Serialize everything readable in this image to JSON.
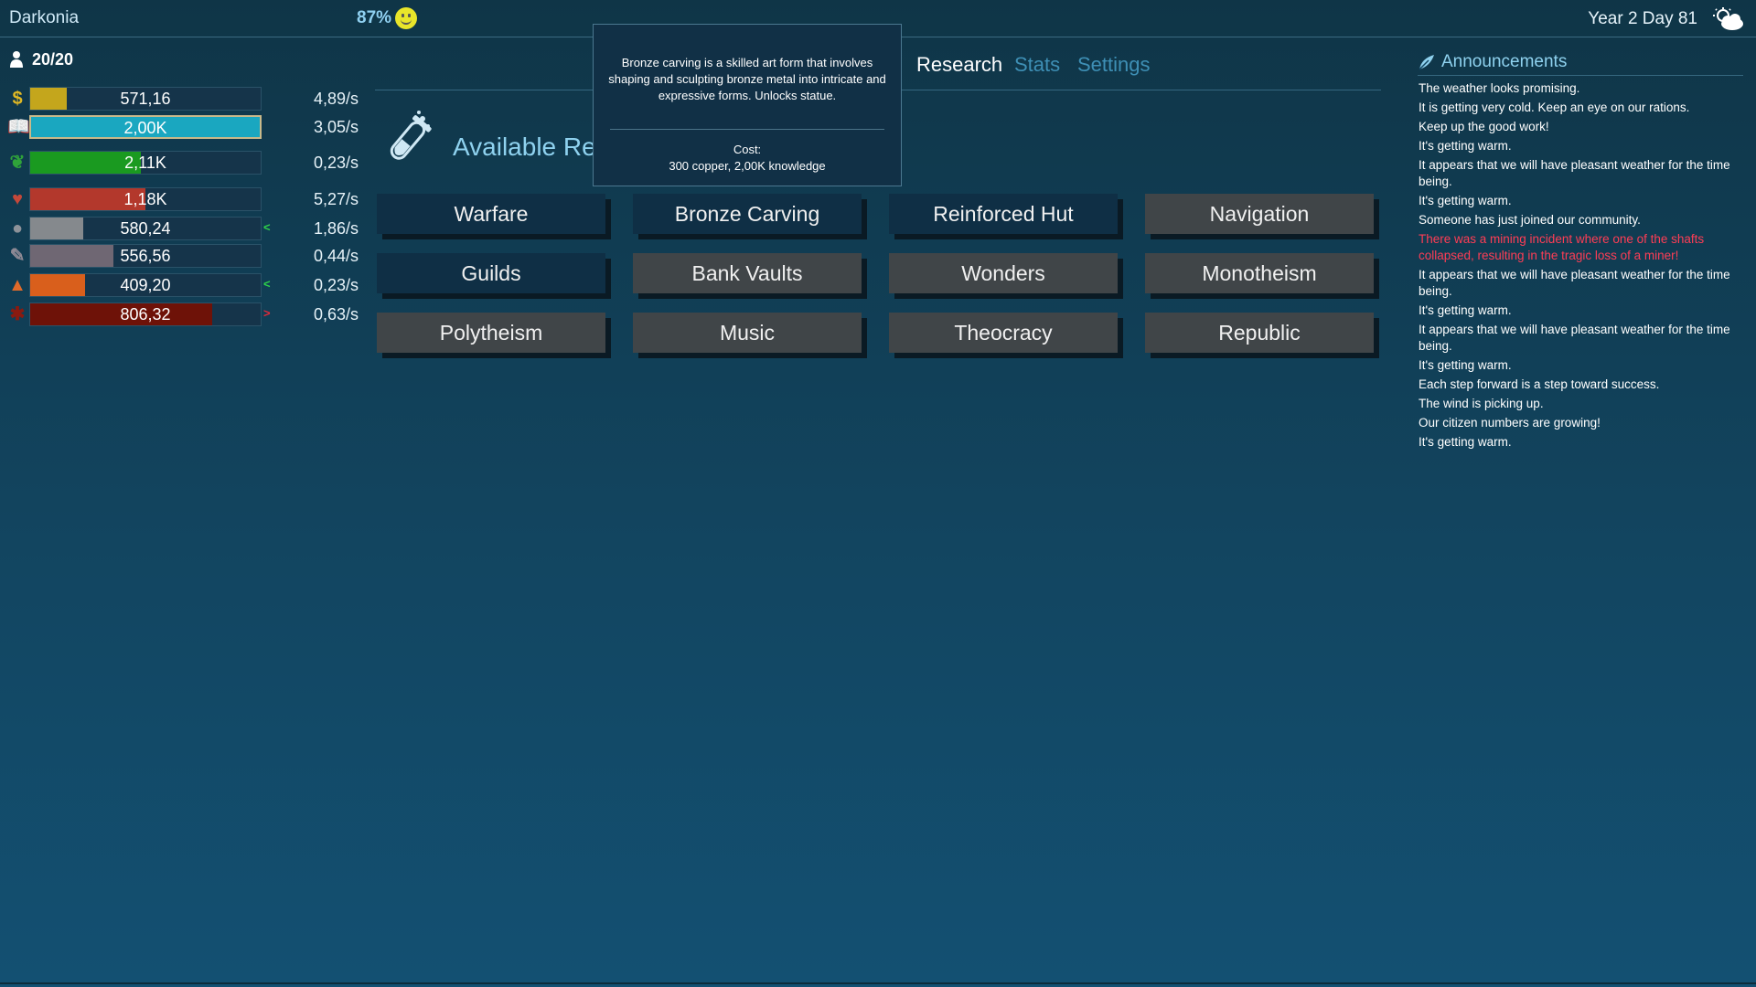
{
  "header": {
    "city_name": "Darkonia",
    "happiness": "87%",
    "date": "Year 2 Day 81",
    "weather_icon": "cloudy-sun-icon"
  },
  "population": {
    "icon": "person-icon",
    "count": "20/20"
  },
  "resources": [
    {
      "icon": "dollar-icon",
      "symbol": "$",
      "icon_color": "#e0b824",
      "value": "571,16",
      "rate": "4,89/s",
      "fill": 0.16,
      "fill_color": "#c4a61c",
      "trend": "",
      "trend_color": ""
    },
    {
      "icon": "book-icon",
      "symbol": "📖",
      "icon_color": "#27a3bd",
      "value": "2,00K",
      "rate": "3,05/s",
      "fill": 1.0,
      "fill_color": "#1aa7c0",
      "trend": "",
      "trend_color": ""
    },
    {
      "icon": "wheat-icon",
      "symbol": "❦",
      "icon_color": "#2fa33a",
      "value": "2,11K",
      "rate": "0,23/s",
      "fill": 0.48,
      "fill_color": "#1a9a20",
      "trend": "",
      "trend_color": ""
    },
    {
      "icon": "meat-icon",
      "symbol": "♥",
      "icon_color": "#c4483a",
      "value": "1,18K",
      "rate": "5,27/s",
      "fill": 0.5,
      "fill_color": "#b3382c",
      "trend": "",
      "trend_color": ""
    },
    {
      "icon": "stone-icon",
      "symbol": "●",
      "icon_color": "#8d9299",
      "value": "580,24",
      "rate": "1,86/s",
      "fill": 0.23,
      "fill_color": "#85898d",
      "trend": "<",
      "trend_color": "#2ed24a"
    },
    {
      "icon": "tool-icon",
      "symbol": "✎",
      "icon_color": "#8f8a95",
      "value": "556,56",
      "rate": "0,44/s",
      "fill": 0.36,
      "fill_color": "#6f6773",
      "trend": "",
      "trend_color": ""
    },
    {
      "icon": "copper-icon",
      "symbol": "▲",
      "icon_color": "#e06a2a",
      "value": "409,20",
      "rate": "0,23/s",
      "fill": 0.24,
      "fill_color": "#d95f1c",
      "trend": "<",
      "trend_color": "#2ed24a"
    },
    {
      "icon": "leather-icon",
      "symbol": "✱",
      "icon_color": "#8a1a10",
      "value": "806,32",
      "rate": "0,63/s",
      "fill": 0.79,
      "fill_color": "#6e1208",
      "trend": ">",
      "trend_color": "#e12a3a"
    }
  ],
  "tabs": {
    "research": "Research",
    "stats": "Stats",
    "settings": "Settings"
  },
  "research": {
    "icon": "flask-icon",
    "title": "Available Research",
    "buttons": [
      {
        "label": "Warfare",
        "state": "affordable"
      },
      {
        "label": "Bronze Carving",
        "state": "affordable"
      },
      {
        "label": "Reinforced Hut",
        "state": "affordable"
      },
      {
        "label": "Navigation",
        "state": "locked"
      },
      {
        "label": "Guilds",
        "state": "affordable"
      },
      {
        "label": "Bank Vaults",
        "state": "locked"
      },
      {
        "label": "Wonders",
        "state": "locked"
      },
      {
        "label": "Monotheism",
        "state": "locked"
      },
      {
        "label": "Polytheism",
        "state": "locked"
      },
      {
        "label": "Music",
        "state": "locked"
      },
      {
        "label": "Theocracy",
        "state": "locked"
      },
      {
        "label": "Republic",
        "state": "locked"
      }
    ]
  },
  "tooltip": {
    "description": "Bronze carving is a skilled art form that involves shaping and sculpting bronze metal into intricate and expressive forms. Unlocks statue.",
    "cost_label": "Cost:",
    "cost": "300 copper, 2,00K knowledge"
  },
  "announcements": {
    "icon": "quill-icon",
    "title": "Announcements",
    "items": [
      {
        "text": "The weather looks promising.",
        "alert": false
      },
      {
        "text": "It is getting very cold. Keep an eye on our rations.",
        "alert": false
      },
      {
        "text": "Keep up the good work!",
        "alert": false
      },
      {
        "text": "It's getting warm.",
        "alert": false
      },
      {
        "text": "It appears that we will have pleasant weather for the time being.",
        "alert": false
      },
      {
        "text": "It's getting warm.",
        "alert": false
      },
      {
        "text": "Someone has just joined our community.",
        "alert": false
      },
      {
        "text": "There was a mining incident where one of the shafts collapsed, resulting in the tragic loss of a miner!",
        "alert": true
      },
      {
        "text": "It appears that we will have pleasant weather for the time being.",
        "alert": false
      },
      {
        "text": "It's getting warm.",
        "alert": false
      },
      {
        "text": "It appears that we will have pleasant weather for the time being.",
        "alert": false
      },
      {
        "text": "It's getting warm.",
        "alert": false
      },
      {
        "text": "Each step forward is a step toward success.",
        "alert": false
      },
      {
        "text": "The wind is picking up.",
        "alert": false
      },
      {
        "text": "Our citizen numbers are growing!",
        "alert": false
      },
      {
        "text": "It's getting warm.",
        "alert": false
      }
    ]
  }
}
